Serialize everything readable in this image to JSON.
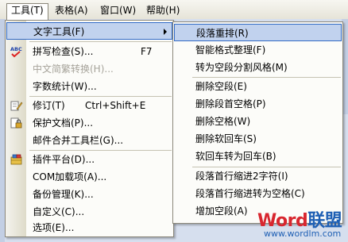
{
  "menubar": {
    "items": [
      {
        "label": "工具(T)",
        "active": true
      },
      {
        "label": "表格(A)"
      },
      {
        "label": "窗口(W)"
      },
      {
        "label": "帮助(H)"
      }
    ]
  },
  "tools_menu": {
    "items": [
      {
        "label": "文字工具(F)",
        "has_submenu": true,
        "highlighted": true
      },
      {
        "label": "拼写检查(S)...",
        "shortcut": "F7",
        "icon": "spellcheck-abc-icon"
      },
      {
        "label": "中文简繁转换(H)...",
        "disabled": true
      },
      {
        "label": "字数统计(W)..."
      },
      {
        "label": "修订(T)",
        "shortcut": "Ctrl+Shift+E",
        "icon": "track-changes-icon"
      },
      {
        "label": "保护文档(P)...",
        "icon": "protect-document-icon"
      },
      {
        "label": "邮件合并工具栏(G)..."
      },
      {
        "label": "插件平台(D)...",
        "icon": "plugin-platform-icon"
      },
      {
        "label": "COM加载项(A)..."
      },
      {
        "label": "备份管理(K)..."
      },
      {
        "label": "自定义(C)..."
      },
      {
        "label": "选项(E)..."
      }
    ]
  },
  "text_tools_submenu": {
    "items": [
      {
        "label": "段落重排(R)",
        "highlighted": true
      },
      {
        "label": "智能格式整理(F)"
      },
      {
        "label": "转为空段分割风格(M)"
      },
      {
        "label": "删除空段(E)"
      },
      {
        "label": "删除段首空格(P)"
      },
      {
        "label": "删除空格(W)"
      },
      {
        "label": "删除软回车(S)"
      },
      {
        "label": "软回车转为回车(B)"
      },
      {
        "label": "段落首行缩进2字符(I)"
      },
      {
        "label": "段落首行缩进转为空格(C)"
      },
      {
        "label": "增加空段(A)"
      }
    ]
  },
  "watermark": {
    "brand_word": "Word",
    "brand_cn": "联盟",
    "url": "www.wordlm.com"
  },
  "colors": {
    "highlight_bg": "#c1d2ee",
    "highlight_border": "#316ac5",
    "watermark_red": "#d8262f",
    "watermark_blue": "#1e5fb4"
  }
}
